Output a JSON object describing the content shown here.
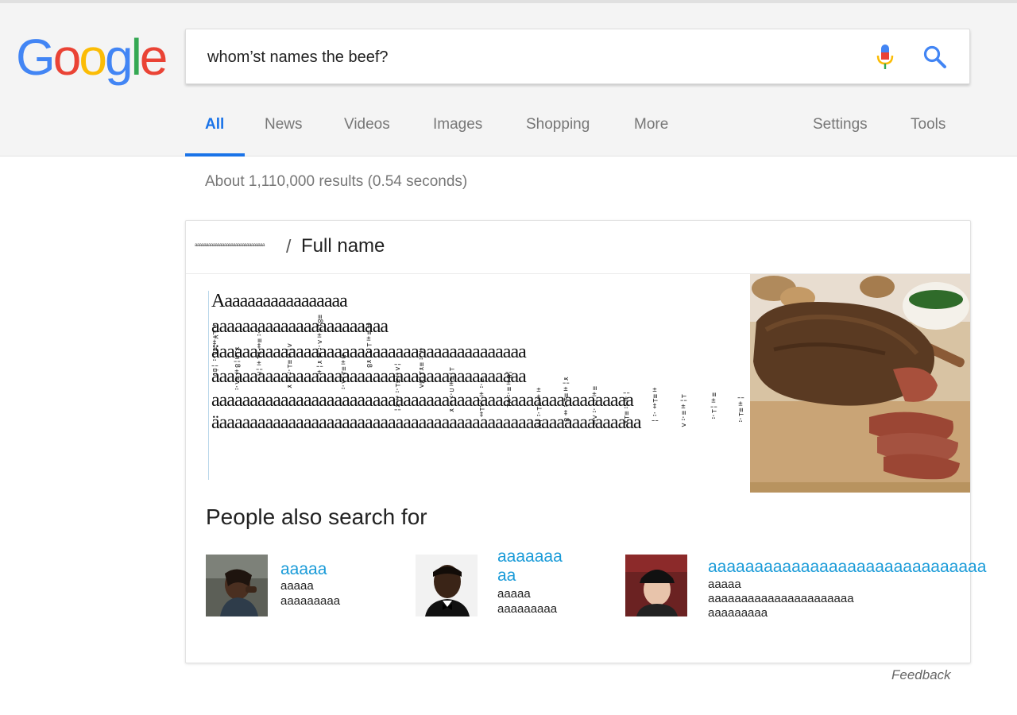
{
  "brand": {
    "logo_letters": [
      "G",
      "o",
      "o",
      "g",
      "l",
      "e"
    ],
    "logo_colors": [
      "#4285F4",
      "#EA4335",
      "#FBBC05",
      "#4285F4",
      "#34A853",
      "#EA4335"
    ]
  },
  "search": {
    "query": "whom’st names the beef?"
  },
  "tabs": [
    {
      "label": "All",
      "active": true
    },
    {
      "label": "News"
    },
    {
      "label": "Videos"
    },
    {
      "label": "Images"
    },
    {
      "label": "Shopping"
    },
    {
      "label": "More"
    },
    {
      "label": "Settings"
    },
    {
      "label": "Tools"
    }
  ],
  "results": {
    "stats": "About 1,110,000 results (0.54 seconds)"
  },
  "knowledge_card": {
    "breadcrumb_small": "aaaaaaaaaaaaaaaaaaaaaaaaaaaaaaa",
    "breadcrumb_separator": "/",
    "title": "Full name",
    "glitch_lines": [
      "Aaaaaaaaaaaaaaaaa",
      "aaaaaaaaaaaaaaaaaaaaaaa",
      "äaaaaaaaaaaaaaaaaaaaaaaaaaaaaaaaaaaaaaaaa",
      "aaaaaaaaaaaaaaaaaaaaaaaaaaaaaaaaaaaaaaaaa",
      "aaaaaaaaaaaaaaaaaaaaaaaaaaaaaaaaaaaaaaaaaaaaaaaaaaaaaaa",
      "äaaaaaaaaaaaaaaaaaaaaaaaaaaaaaaaaaaaaaaaaaaaaaaaaaaaaaaa"
    ],
    "image_alt": "roast-beef",
    "people_also_search_title": "People also search for",
    "people": [
      {
        "name_lines": [
          "aaaaa"
        ],
        "desc_lines": [
          "aaaaa",
          "aaaaaaaaa"
        ]
      },
      {
        "name_lines": [
          "aaaaaaa",
          "aa"
        ],
        "desc_lines": [
          "aaaaa",
          "aaaaaaaaa"
        ]
      },
      {
        "name_lines": [
          "aaaaaaaaaaaaaaaaaaaaaaaaaaaaaa"
        ],
        "desc_lines": [
          "aaaaa",
          "aaaaaaaaaaaaaaaaaaaaaa",
          "aaaaaaaaa"
        ]
      }
    ]
  },
  "footer": {
    "feedback": "Feedback"
  },
  "colors": {
    "accent_blue": "#1a73e8",
    "link_blue": "#1a9bd8",
    "tab_gray": "#777777"
  }
}
